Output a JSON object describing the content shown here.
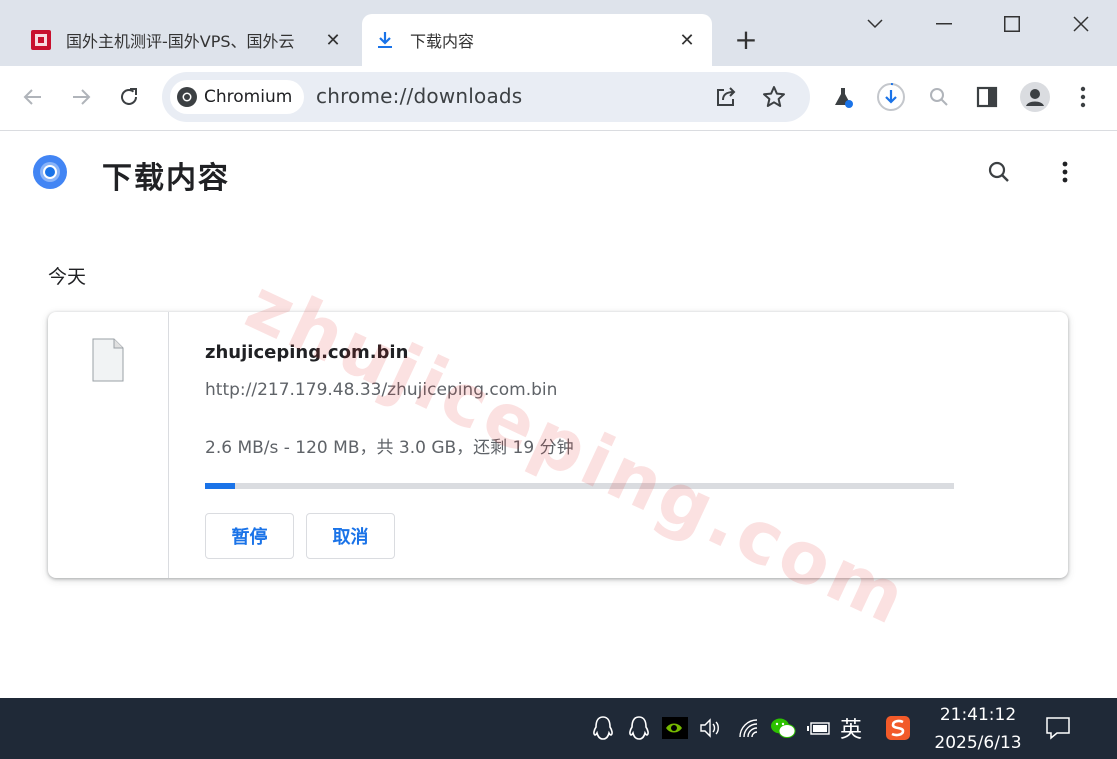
{
  "tabs": [
    {
      "title": "国外主机测评-国外VPS、国外云",
      "close": "✕"
    },
    {
      "title": "下载内容",
      "close": "✕"
    }
  ],
  "new_tab": "+",
  "toolbar": {
    "site_chip": "Chromium",
    "url": "chrome://downloads"
  },
  "page": {
    "title": "下载内容",
    "section": "今天"
  },
  "download": {
    "filename": "zhujiceping.com.bin",
    "url": "http://217.179.48.33/zhujiceping.com.bin",
    "status": "2.6 MB/s - 120 MB，共 3.0 GB，还剩 19 分钟",
    "progress_fraction": 0.04,
    "pause_label": "暂停",
    "cancel_label": "取消"
  },
  "watermark": "zhujiceping.com",
  "taskbar": {
    "ime": "英",
    "time": "21:41:12",
    "date": "2025/6/13"
  },
  "colors": {
    "accent": "#1a73e8",
    "tabstrip": "#dee3eb",
    "taskbar": "#1f2937"
  }
}
